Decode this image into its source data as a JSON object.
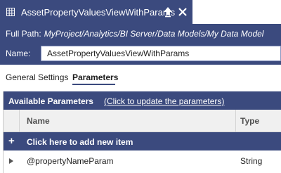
{
  "tab": {
    "title": "AssetPropertyValuesViewWithParams",
    "icon": "grid-table-icon",
    "pin_icon": "pin-icon",
    "close_icon": "close-icon"
  },
  "header": {
    "full_path_label": "Full Path:",
    "full_path_value": "MyProject/Analytics/BI Server/Data Models/My Data Model",
    "name_label": "Name:",
    "name_value": "AssetPropertyValuesViewWithParams"
  },
  "subtabs": [
    {
      "label": "General Settings",
      "active": false
    },
    {
      "label": "Parameters",
      "active": true
    }
  ],
  "panel": {
    "title": "Available Parameters",
    "update_link": "(Click to update the parameters)",
    "columns": {
      "name": "Name",
      "type": "Type"
    },
    "add_row_label": "Click here to add new item",
    "add_icon": "plus-icon",
    "rows": [
      {
        "name": "@propertyNameParam",
        "type": "String"
      }
    ]
  },
  "colors": {
    "accent": "#3b4a7e",
    "header_background": "#f0f0f0"
  }
}
